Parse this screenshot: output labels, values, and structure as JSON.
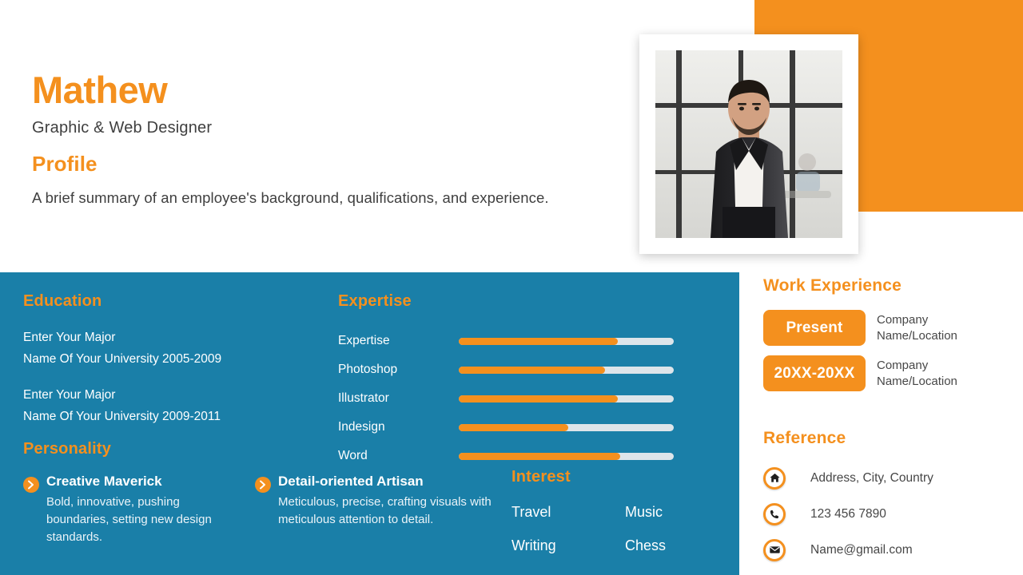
{
  "header": {
    "name": "Mathew",
    "job_title": "Graphic & Web Designer",
    "profile_heading": "Profile",
    "profile_text": "A brief summary of an employee's background, qualifications, and experience."
  },
  "photo": {
    "alt_name": "profile-photo",
    "description": "Man in dark suit and white shirt standing in an office"
  },
  "education": {
    "heading": "Education",
    "entries": [
      {
        "major": "Enter Your Major",
        "university": "Name Of Your University 2005-2009"
      },
      {
        "major": "Enter Your Major",
        "university": "Name Of Your University 2009-2011"
      }
    ]
  },
  "personality": {
    "heading": "Personality",
    "items": [
      {
        "title": "Creative Maverick",
        "description": "Bold, innovative, pushing boundaries, setting new design standards."
      },
      {
        "title": "Detail-oriented Artisan",
        "description": "Meticulous, precise, crafting visuals with meticulous attention to detail."
      }
    ]
  },
  "expertise": {
    "heading": "Expertise",
    "skills": [
      {
        "label": "Expertise",
        "value": 74
      },
      {
        "label": "Photoshop",
        "value": 68
      },
      {
        "label": "Illustrator",
        "value": 74
      },
      {
        "label": "Indesign",
        "value": 51
      },
      {
        "label": "Word",
        "value": 75
      }
    ]
  },
  "interest": {
    "heading": "Interest",
    "items": [
      "Travel",
      "Music",
      "Writing",
      "Chess"
    ]
  },
  "work_experience": {
    "heading": "Work Experience",
    "entries": [
      {
        "period": "Present",
        "company": "Company",
        "location": "Name/Location"
      },
      {
        "period": "20XX-20XX",
        "company": "Company",
        "location": "Name/Location"
      }
    ]
  },
  "reference": {
    "heading": "Reference",
    "items": [
      {
        "icon": "home-icon",
        "text": "Address, City, Country"
      },
      {
        "icon": "phone-icon",
        "text": "123 456 7890"
      },
      {
        "icon": "envelope-icon",
        "text": "Name@gmail.com"
      }
    ]
  },
  "colors": {
    "accent_orange": "#F4901E",
    "panel_teal": "#1A7FA8",
    "track_gray": "#DDE5EA",
    "text_dark": "#3F3F3F",
    "white": "#FFFFFF"
  }
}
